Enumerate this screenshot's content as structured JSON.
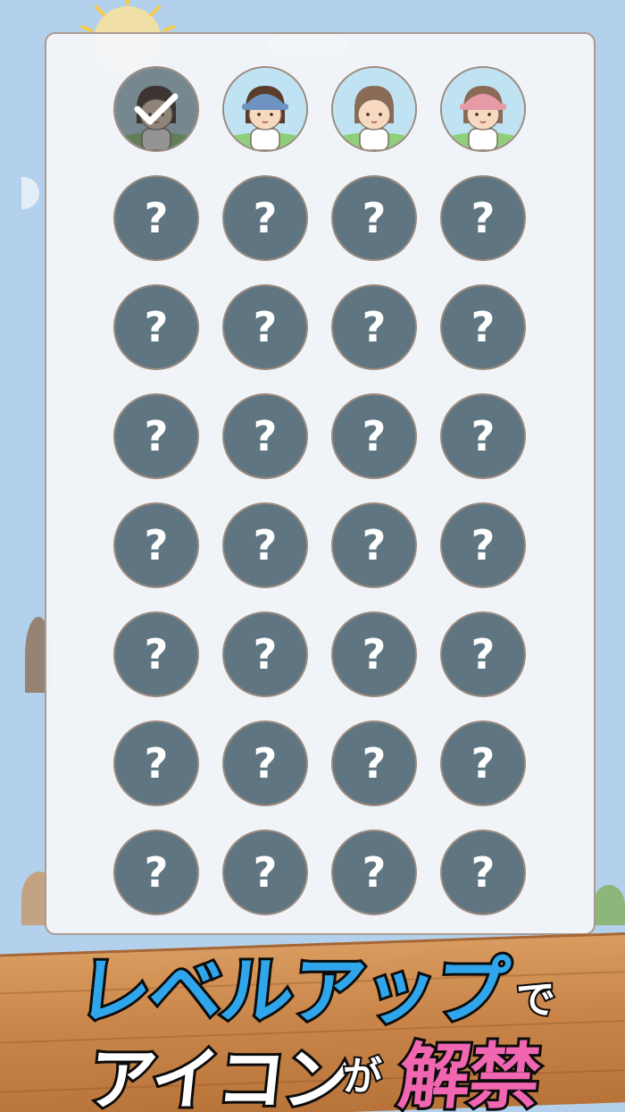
{
  "grid": {
    "unlocked": [
      {
        "name": "avatar-dark-hair-selected",
        "selected": true,
        "hair": "#3a2b22",
        "cap": null
      },
      {
        "name": "avatar-blue-cap",
        "selected": false,
        "hair": "#5b3b2a",
        "cap": "#6e93c2"
      },
      {
        "name": "avatar-brown-hair",
        "selected": false,
        "hair": "#8a6b55",
        "cap": null
      },
      {
        "name": "avatar-pink-cap",
        "selected": false,
        "hair": "#8a6b55",
        "cap": "#e69aa6"
      }
    ],
    "locked_symbol": "?",
    "locked_count": 28,
    "columns": 4
  },
  "banner": {
    "line1": "レベルアップ",
    "particle1": "で",
    "line2": "アイコン",
    "particle2": "が",
    "highlight": "解禁"
  },
  "colors": {
    "background": "#b3d0ec",
    "locked_slot": "#5f7682",
    "title_blue": "#2fa6ec",
    "highlight_pink": "#f066b0",
    "plank": "#c98549"
  }
}
